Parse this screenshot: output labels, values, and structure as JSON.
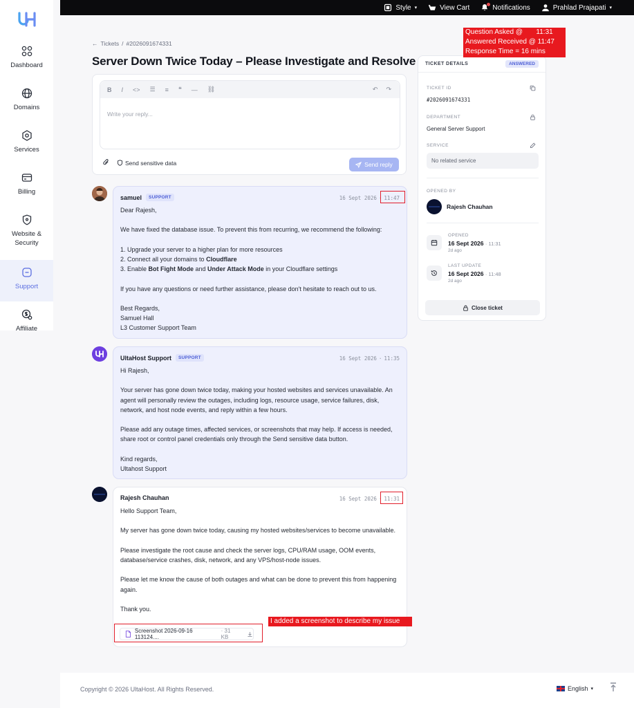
{
  "topbar": {
    "style_label": "Style",
    "cart_label": "View Cart",
    "notifications_label": "Notifications",
    "user_name": "Prahlad Prajapati"
  },
  "sidebar": {
    "items": [
      {
        "label": "Dashboard",
        "icon": "grid-icon"
      },
      {
        "label": "Domains",
        "icon": "globe-icon"
      },
      {
        "label": "Services",
        "icon": "hexagon-icon"
      },
      {
        "label": "Billing",
        "icon": "card-icon"
      },
      {
        "label": "Website & Security",
        "icon": "shield-icon"
      },
      {
        "label": "Support",
        "icon": "support-icon",
        "active": true
      },
      {
        "label": "Affiliate",
        "icon": "dollar-icon"
      }
    ]
  },
  "breadcrumb": {
    "root": "Tickets",
    "separator": "/",
    "current": "#2026091674331"
  },
  "page_title": "Server Down Twice Today – Please Investigate and Resolve",
  "composer": {
    "placeholder": "Write your reply...",
    "sensitive_label": "Send sensitive data",
    "send_label": "Send reply"
  },
  "messages": [
    {
      "author": "samuel",
      "badge": "SUPPORT",
      "date": "16 Sept 2026",
      "time": "11:47",
      "greeting": "Dear Rajesh,",
      "intro": "We have fixed the database issue. To prevent this from recurring, we recommend the following:",
      "step1": "1. Upgrade your server to a higher plan for more resources",
      "step2_prefix": "2. Connect all your domains to ",
      "step2_bold": "Cloudflare",
      "step3_prefix": "3. Enable ",
      "step3_bold1": "Bot Fight Mode",
      "step3_mid": " and ",
      "step3_bold2": "Under Attack Mode",
      "step3_suffix": " in your Cloudflare settings",
      "closing": "If you have any questions or need further assistance, please don't hesitate to reach out to us.",
      "sign1": "Best Regards,",
      "sign2": "Samuel Hall",
      "sign3": "L3 Customer Support Team"
    },
    {
      "author": "UltaHost Support",
      "badge": "SUPPORT",
      "date": "16 Sept 2026",
      "time": "11:35",
      "greeting": "Hi Rajesh,",
      "p1": "Your server has gone down twice today, making your hosted websites and services unavailable. An agent will personally review the outages, including logs, resource usage, service failures, disk, network, and host node events, and reply within a few hours.",
      "p2": "Please add any outage times, affected services, or screenshots that may help. If access is needed, share root or control panel credentials only through the Send sensitive data button.",
      "sign1": "Kind regards,",
      "sign2": "Ultahost Support"
    },
    {
      "author": "Rajesh Chauhan",
      "date": "16 Sept 2026",
      "time": "11:31",
      "greeting": "Hello Support Team,",
      "p1": "My server has gone down twice today, causing my hosted websites/services to become unavailable.",
      "p2": "Please investigate the root cause and check the server logs, CPU/RAM usage, OOM events, database/service crashes, disk, network, and any VPS/host-node issues.",
      "p3": "Please let me know the cause of both outages and what can be done to prevent this from happening again.",
      "sign1": "Thank you.",
      "attachment_name": "Screenshot 2026-09-16 113124....",
      "attachment_size": "· 31 KB"
    }
  ],
  "details": {
    "title": "TICKET DETAILS",
    "status": "ANSWERED",
    "ticket_id_label": "TICKET ID",
    "ticket_id": "#2026091674331",
    "department_label": "DEPARTMENT",
    "department": "General Server Support",
    "service_label": "SERVICE",
    "service": "No related service",
    "opened_by_label": "OPENED BY",
    "opened_by": "Rajesh Chauhan",
    "opened_label": "OPENED",
    "opened_date": "16 Sept 2026",
    "opened_time": "· 11:31",
    "opened_ago": "2d ago",
    "updated_label": "LAST UPDATE",
    "updated_date": "16 Sept 2026",
    "updated_time": "· 11:48",
    "updated_ago": "2d ago",
    "close_label": "Close ticket"
  },
  "annotations": {
    "top_line1": "Question Asked @       11:31",
    "top_line2": "Answered Received @ 11:47",
    "top_line3": "Response Time = 16 mins",
    "screenshot_note": "I added a screenshot to describe my issue"
  },
  "footer": {
    "copyright": "Copyright © 2026 UltaHost. All Rights Reserved.",
    "language": "English"
  },
  "colors": {
    "accent": "#5b6ee1",
    "support_bubble": "#eef0fd",
    "annotation_red": "#e8191f",
    "topbar": "#0b0b0d"
  }
}
